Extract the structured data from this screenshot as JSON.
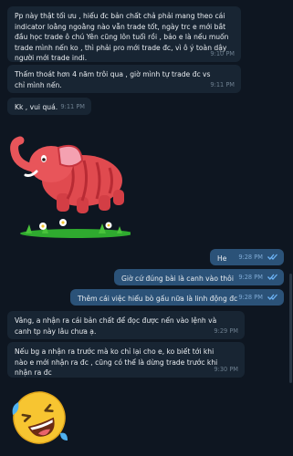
{
  "messages": [
    {
      "direction": "incoming",
      "text": "Pp này thật tối ưu , hiểu đc bản chất chả phải mang theo cái indicator loằng ngoằng nào vẫn trade tốt, ngày trc e mới bắt đầu học trade ô chú Yên cũng lôn tuổi rồi , bảo e là nếu muốn trade mình nến ko , thì phải pro mới trade đc, vì ô ý toàn dậy người mới trade indi.",
      "time": "9:10 PM"
    },
    {
      "direction": "incoming",
      "text": "Thấm thoát hơn 4 năm trôi qua , giờ mình tự trade đc vs chỉ mình nến.",
      "time": "9:11 PM"
    },
    {
      "direction": "incoming",
      "text": "Kk , vui quá.",
      "time": "9:11 PM"
    },
    {
      "direction": "incoming",
      "sticker": "red-elephant-sticker"
    },
    {
      "direction": "outgoing",
      "text": "He",
      "time": "9:28 PM",
      "status": "read-double-check"
    },
    {
      "direction": "outgoing",
      "text": "Giờ cứ đúng bài là canh vào thôi",
      "time": "9:28 PM",
      "status": "read-double-check"
    },
    {
      "direction": "outgoing",
      "text": "Thêm cái việc hiểu bò gấu nữa là linh động đc",
      "time": "9:28 PM",
      "status": "read-double-check"
    },
    {
      "direction": "incoming",
      "text": "Vâng, a nhận ra cái bản chất để đọc được nến vào lệnh và canh tp này lâu chưa ạ.",
      "time": "9:29 PM"
    },
    {
      "direction": "incoming",
      "text": "Nếu bg a nhận ra trước mà ko chỉ lại cho e, ko biết tới khi nào e mới nhận ra đc , cũng có thể là dừng trade trước khi nhận ra đc",
      "time": "9:30 PM"
    },
    {
      "direction": "incoming",
      "sticker": "rolling-laughing-emoji"
    }
  ],
  "colors": {
    "background": "#0e1621",
    "incoming_bubble": "#182533",
    "outgoing_bubble": "#2b5278",
    "read_check": "#6cb3f5"
  }
}
